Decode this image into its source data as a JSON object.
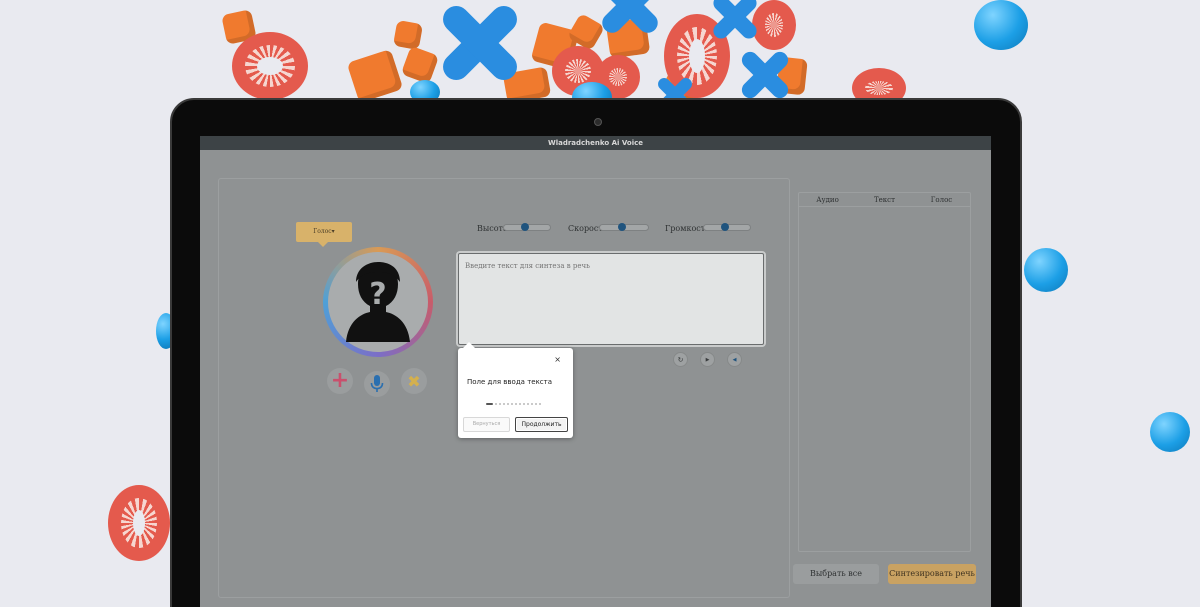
{
  "window": {
    "title": "Wladradchenko Ai Voice"
  },
  "voice_select": {
    "label": "Голос▾"
  },
  "sliders": [
    {
      "label": "Высота",
      "value": 0.45
    },
    {
      "label": "Скорость",
      "value": 0.45
    },
    {
      "label": "Громкость",
      "value": 0.45
    }
  ],
  "text_input": {
    "placeholder": "Введите текст для синтеза в речь"
  },
  "tooltip": {
    "close": "×",
    "text": "Поле для ввода текста",
    "back_label": "Вернуться",
    "next_label": "Продолжить",
    "step_count": 13,
    "current_step": 1
  },
  "table": {
    "headers": [
      "Аудио",
      "Текст",
      "Голос"
    ]
  },
  "buttons": {
    "select_all": "Выбрать все",
    "synthesize": "Синтезировать речь"
  },
  "icons": {
    "add": "+",
    "close": "✖",
    "repeat": "↻",
    "play": "▶",
    "volume": "◀"
  },
  "colors": {
    "accent_gold": "#c9a262",
    "add_pink": "#c9506d",
    "mic_blue": "#2a6fb0",
    "remove_gold": "#d4b04d"
  }
}
